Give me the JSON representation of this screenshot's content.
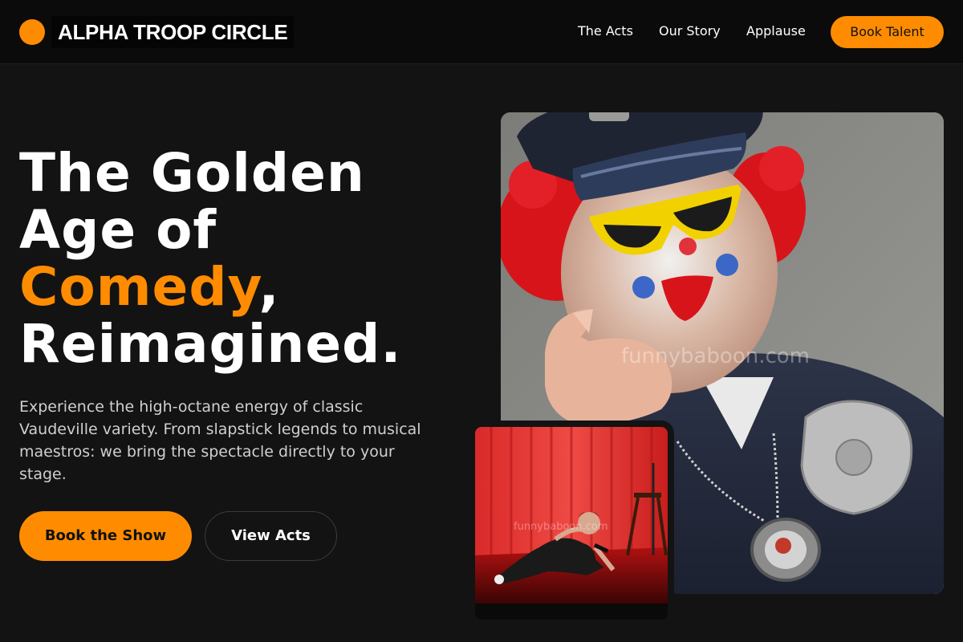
{
  "brand": {
    "name": "ALPHA TROOP CIRCLE",
    "logo_icon": "circle-logo-icon",
    "accent_color": "#ff8c00"
  },
  "nav": {
    "links": [
      {
        "label": "The Acts"
      },
      {
        "label": "Our Story"
      },
      {
        "label": "Applause"
      }
    ],
    "cta_label": "Book Talent"
  },
  "hero": {
    "headline_line1": "The Golden",
    "headline_line2": "Age of",
    "headline_accent": "Comedy",
    "headline_punct": ",",
    "headline_line4": "Reimagined.",
    "description": "Experience the high-octane energy of classic Vaudeville variety. From slapstick legends to musical maestros: we bring the spectacle directly to your stage.",
    "primary_button": "Book the Show",
    "secondary_button": "View Acts"
  },
  "images": {
    "main_photo": {
      "subject": "clown in police costume pointing at viewer",
      "watermark": "funnybaboon.com"
    },
    "inset_photo": {
      "subject": "comedian lying on stage with microphone in front of red curtain",
      "watermark": "funnybaboon.com"
    }
  },
  "colors": {
    "background": "#131313",
    "navbar": "#0b0b0b",
    "accent": "#ff8c00",
    "text": "#ffffff",
    "muted_text": "#cfcfcf"
  }
}
